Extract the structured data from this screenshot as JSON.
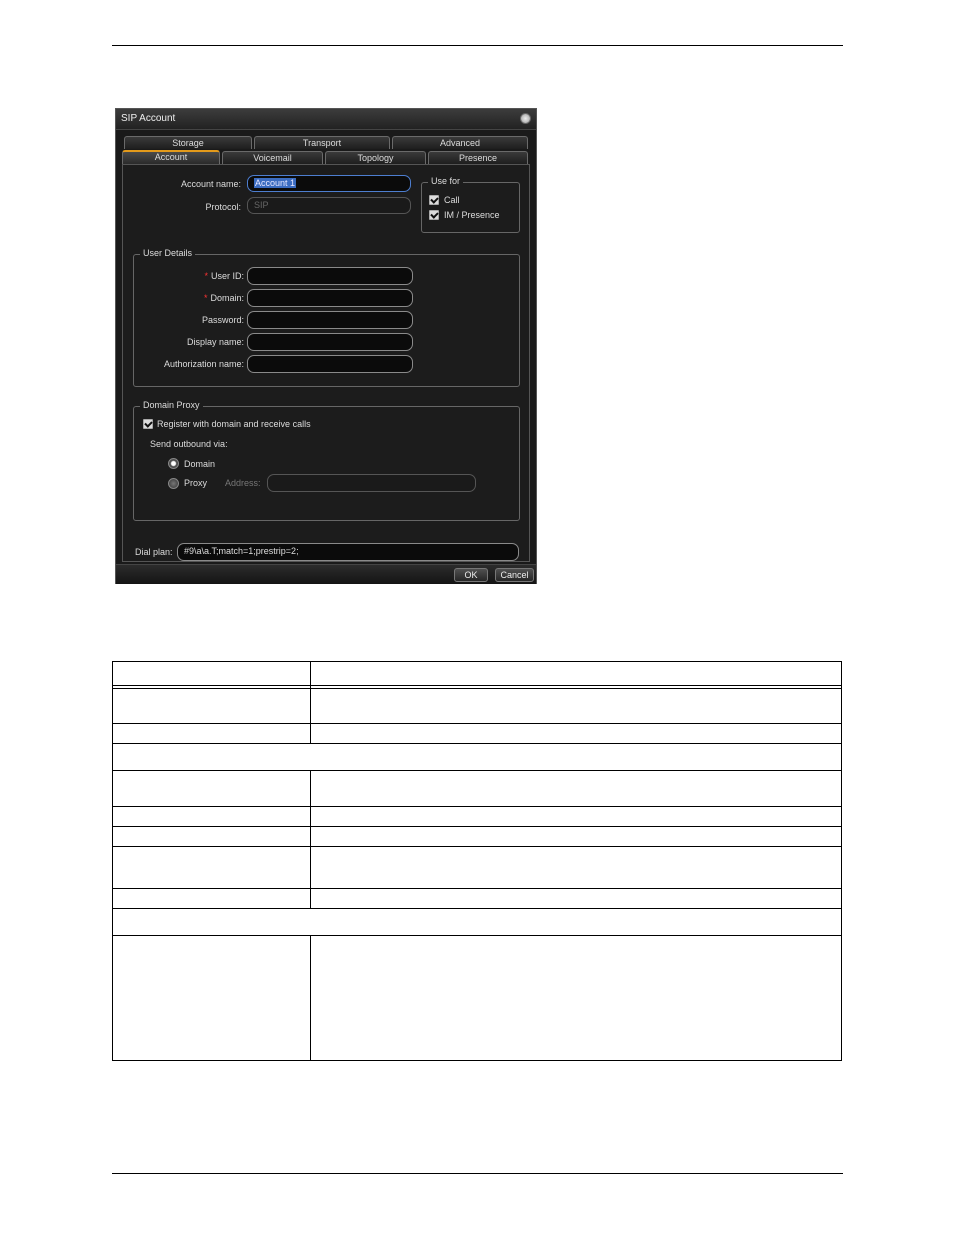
{
  "dialog": {
    "title": "SIP Account",
    "tabs_top": [
      "Storage",
      "Transport",
      "Advanced"
    ],
    "tabs_bottom": [
      "Account",
      "Voicemail",
      "Topology",
      "Presence"
    ],
    "account_name_label": "Account name:",
    "account_name_value": "Account 1",
    "protocol_label": "Protocol:",
    "protocol_value": "SIP",
    "use_for": {
      "legend": "Use for",
      "call_label": "Call",
      "im_label": "IM / Presence"
    },
    "user_details": {
      "legend": "User Details",
      "required_mark": "*",
      "user_id_label": "User ID:",
      "domain_label": "Domain:",
      "password_label": "Password:",
      "display_name_label": "Display name:",
      "authorization_name_label": "Authorization name:"
    },
    "domain_proxy": {
      "legend": "Domain Proxy",
      "register_label": "Register with domain and receive calls",
      "send_outbound_label": "Send outbound via:",
      "domain_option": "Domain",
      "proxy_option": "Proxy",
      "address_label": "Address:"
    },
    "dial_plan_label": "Dial plan:",
    "dial_plan_value": "#9\\a\\a.T;match=1;prestrip=2;",
    "ok_label": "OK",
    "cancel_label": "Cancel"
  }
}
